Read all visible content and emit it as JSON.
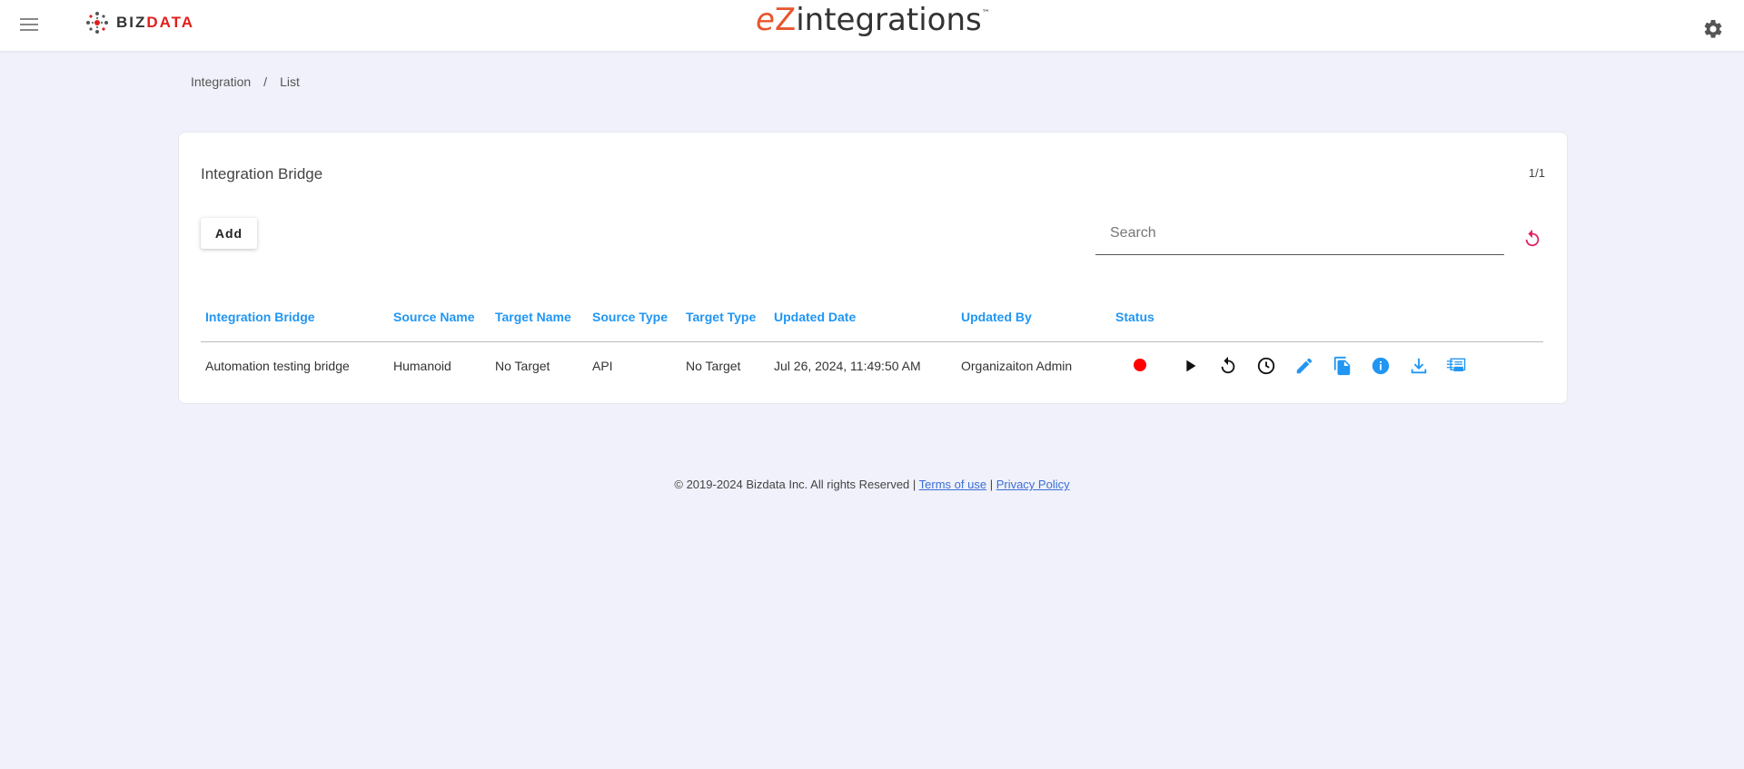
{
  "header": {
    "brand_part1": "BIZ",
    "brand_part2": "DATA",
    "app_logo_e": "e",
    "app_logo_z": "Z",
    "app_logo_rest": "integrations",
    "app_logo_tm": "™"
  },
  "breadcrumb": {
    "item1": "Integration",
    "separator": "/",
    "item2": "List"
  },
  "card": {
    "title": "Integration Bridge",
    "page_count": "1/1",
    "add_label": "Add",
    "search_placeholder": "Search"
  },
  "table": {
    "headers": [
      "Integration Bridge",
      "Source Name",
      "Target Name",
      "Source Type",
      "Target Type",
      "Updated Date",
      "Updated By",
      "Status"
    ],
    "rows": [
      {
        "bridge": "Automation testing bridge",
        "source_name": "Humanoid",
        "target_name": "No Target",
        "source_type": "API",
        "target_type": "No Target",
        "updated_date": "Jul 26, 2024, 11:49:50 AM",
        "updated_by": "Organizaiton Admin",
        "status_color": "#ff0000"
      }
    ]
  },
  "footer": {
    "copyright": "© 2019-2024 Bizdata Inc. All rights Reserved | ",
    "terms": "Terms of use",
    "divider": " | ",
    "privacy": "Privacy Policy"
  },
  "colors": {
    "accent": "#2196f3",
    "brand_red": "#e0201b",
    "logo_orange": "#e8552c",
    "refresh": "#e0245e"
  },
  "icons": [
    "menu-icon",
    "settings-gear-icon",
    "refresh-icon",
    "play-icon",
    "restart-icon",
    "schedule-clock-icon",
    "edit-pencil-icon",
    "copy-icon",
    "info-icon",
    "download-icon",
    "log-icon"
  ]
}
